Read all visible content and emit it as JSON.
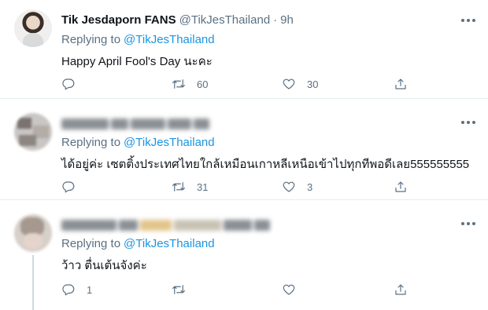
{
  "colors": {
    "link": "#1b95e0",
    "secondary": "#5b7083",
    "divider": "#e6ecf0"
  },
  "tweets": [
    {
      "name": "Tik Jesdaporn FANS",
      "handle": "@TikJesThailand",
      "separator": "·",
      "time": "9h",
      "replying_prefix": "Replying to",
      "replying_to": "@TikJesThailand",
      "text": "Happy April Fool's Day นะคะ",
      "reply_count": "",
      "retweet_count": "60",
      "like_count": "30"
    },
    {
      "replying_prefix": "Replying to",
      "replying_to": "@TikJesThailand",
      "text": "ได้อยู่ค่ะ เซตติ้งประเทศไทยใกล้เหมือนเกาหลีเหนือเข้าไปทุกทีพอดีเลย555555555",
      "reply_count": "",
      "retweet_count": "31",
      "like_count": "3"
    },
    {
      "replying_prefix": "Replying to",
      "replying_to": "@TikJesThailand",
      "text": "ว้าว ตื่นเต้นจังค่ะ",
      "reply_count": "1",
      "retweet_count": "",
      "like_count": ""
    }
  ]
}
